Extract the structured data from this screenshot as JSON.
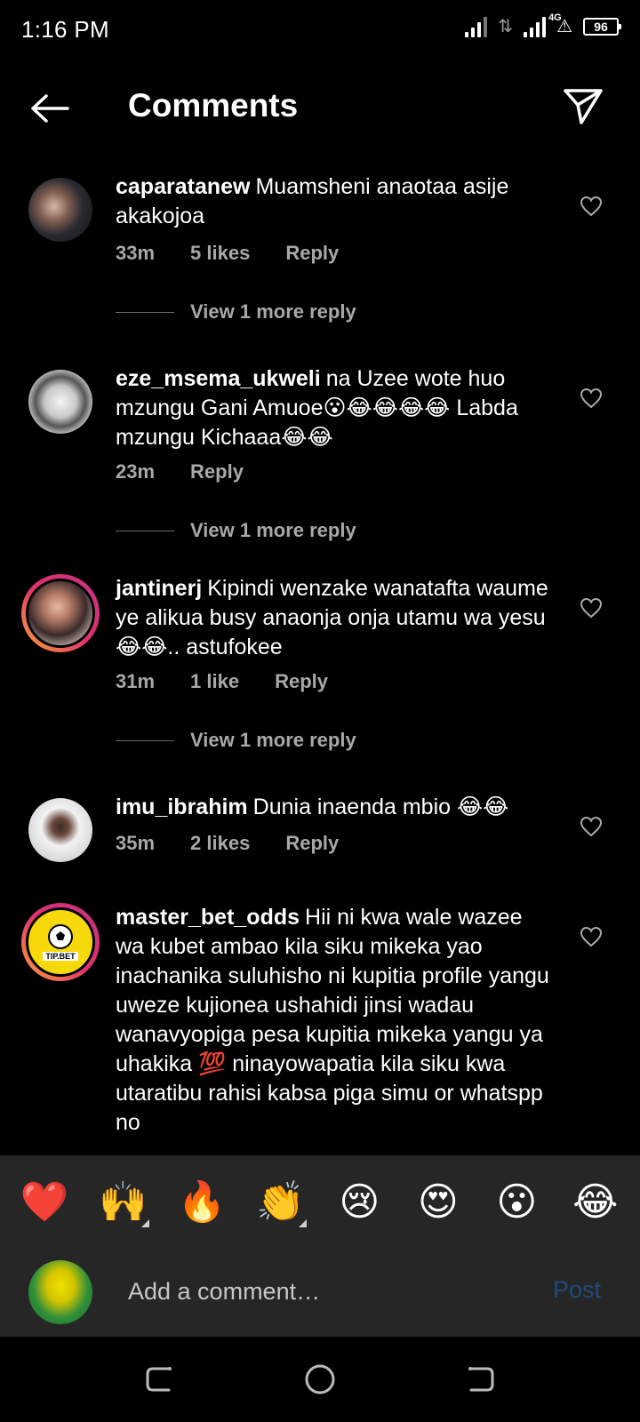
{
  "status_bar": {
    "time": "1:16 PM",
    "network": "4G",
    "battery": "96"
  },
  "header": {
    "title": "Comments"
  },
  "comments": [
    {
      "username": "caparatanew",
      "text": "Muamsheni anaotaa asije akakojoa",
      "time": "33m",
      "likes": "5 likes",
      "reply": "Reply",
      "view_replies": "View 1 more reply"
    },
    {
      "username": "eze_msema_ukweli",
      "text": "na Uzee wote huo mzungu Gani Amuoe😮😂😂😂😂 Labda mzungu Kichaaa😂😂",
      "time": "23m",
      "reply": "Reply",
      "view_replies": "View 1 more reply"
    },
    {
      "username": "jantinerj",
      "text": "Kipindi wenzake wanatafta waume ye alikua busy anaonja onja utamu wa yesu😂😂.. astufokee",
      "time": "31m",
      "likes": "1 like",
      "reply": "Reply",
      "view_replies": "View 1 more reply"
    },
    {
      "username": "imu_ibrahim",
      "text": "Dunia inaenda mbio 😂😂",
      "time": "35m",
      "likes": "2 likes",
      "reply": "Reply"
    },
    {
      "username": "master_bet_odds",
      "text": "Hii ni kwa wale wazee wa kubet ambao kila siku mikeka yao inachanika suluhisho ni kupitia profile yangu uweze kujionea ushahidi jinsi wadau wanavyopiga pesa kupitia mikeka yangu ya uhakika 💯 ninayowapatia kila siku kwa utaratibu rahisi kabsa piga simu or whatspp no",
      "avatar_text": "TIP.BET"
    }
  ],
  "emoji_bar": [
    "❤️",
    "🙌",
    "🔥",
    "👏",
    "😢",
    "😍",
    "😮",
    "😂"
  ],
  "composer": {
    "placeholder": "Add a comment…",
    "post_label": "Post"
  },
  "colors": {
    "background": "#000000",
    "muted": "#a8a8a8",
    "panel": "#262626",
    "post_disabled": "#1f4c7c"
  }
}
